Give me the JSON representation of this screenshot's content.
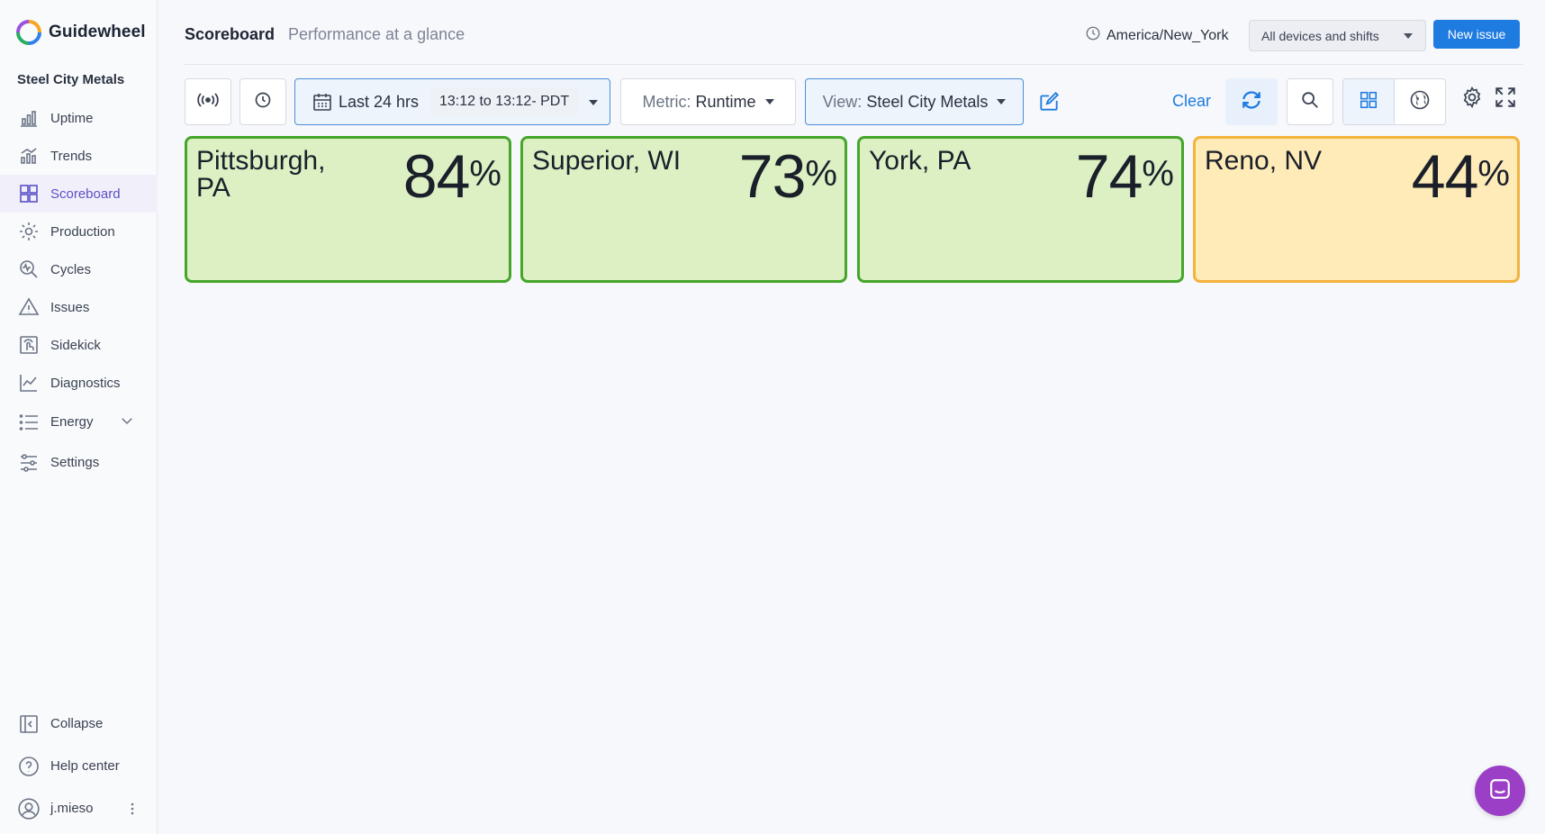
{
  "brand": {
    "name": "Guidewheel"
  },
  "sidebar": {
    "org_name": "Steel City Metals",
    "items": [
      {
        "label": "Uptime",
        "icon": "bar-chart-icon"
      },
      {
        "label": "Trends",
        "icon": "trends-icon"
      },
      {
        "label": "Scoreboard",
        "icon": "grid-icon",
        "active": true
      },
      {
        "label": "Production",
        "icon": "gear-icon"
      },
      {
        "label": "Cycles",
        "icon": "cycles-icon"
      },
      {
        "label": "Issues",
        "icon": "warning-icon"
      },
      {
        "label": "Sidekick",
        "icon": "sidekick-icon"
      },
      {
        "label": "Diagnostics",
        "icon": "line-chart-icon"
      },
      {
        "label": "Energy",
        "icon": "list-icon"
      },
      {
        "label": "Settings",
        "icon": "sliders-icon"
      }
    ],
    "bottom": {
      "collapse_label": "Collapse",
      "help_label": "Help center",
      "user_label": "j.mieso"
    }
  },
  "header": {
    "title": "Scoreboard",
    "subtitle": "Performance at a glance",
    "timezone": "America/New_York",
    "devices_select": "All devices and shifts",
    "new_issue_label": "New issue"
  },
  "toolbar": {
    "range_label": "Last 24 hrs",
    "range_time": "13:12 to 13:12- PDT",
    "metric_key": "Metric:",
    "metric_value": "Runtime",
    "view_key": "View:",
    "view_value": "Steel City Metals",
    "clear_label": "Clear"
  },
  "colors": {
    "accent": "#1e7be0",
    "good_bg": "#dcf0c4",
    "good_border": "#45a62a",
    "warn_bg": "#feebb7",
    "warn_border": "#f3b33d",
    "chat": "#9b3fc7"
  },
  "cards": [
    {
      "name": "Pittsburgh, PA",
      "value": "84",
      "unit": "%",
      "status": "good"
    },
    {
      "name": "Superior, WI",
      "value": "73",
      "unit": "%",
      "status": "good"
    },
    {
      "name": "York, PA",
      "value": "74",
      "unit": "%",
      "status": "good"
    },
    {
      "name": "Reno, NV",
      "value": "44",
      "unit": "%",
      "status": "warn"
    }
  ]
}
